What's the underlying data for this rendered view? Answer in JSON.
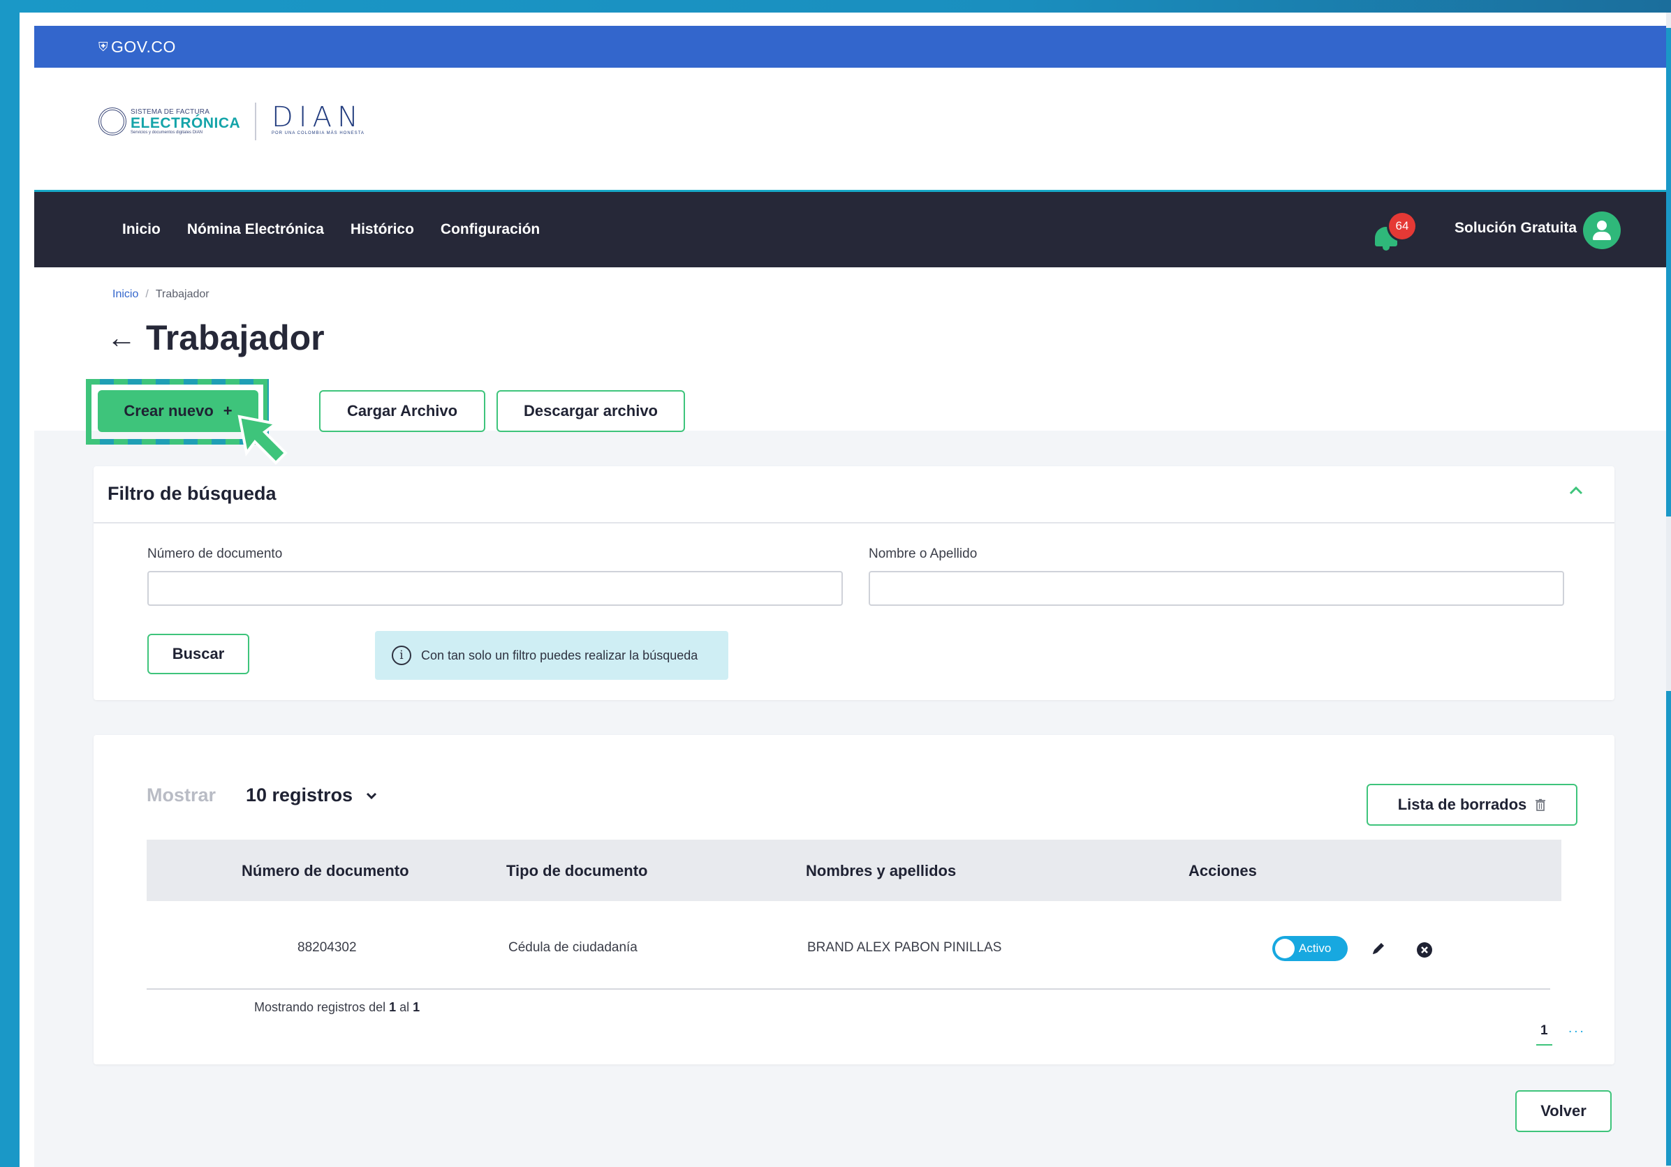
{
  "gov": {
    "logo_text": "GOV.CO"
  },
  "brand": {
    "fe_small": "SISTEMA DE FACTURA",
    "fe_big": "ELECTRÓNICA",
    "fe_sub": "Servicios y documentos digitales DIAN",
    "dian": "DIAN",
    "dian_slogan": "POR UNA COLOMBIA MÁS HONESTA"
  },
  "nav": {
    "items": [
      {
        "label": "Inicio"
      },
      {
        "label": "Nómina Electrónica"
      },
      {
        "label": "Histórico"
      },
      {
        "label": "Configuración"
      }
    ],
    "notifications_count": "64",
    "user_name": "Solución Gratuita",
    "accent_color": "#3ec47b"
  },
  "breadcrumb": {
    "home": "Inicio",
    "separator": "/",
    "current": "Trabajador"
  },
  "page": {
    "title": "Trabajador",
    "back_icon": "←"
  },
  "actions": {
    "create_label": "Crear nuevo",
    "create_icon": "+",
    "upload_label": "Cargar Archivo",
    "download_label": "Descargar archivo"
  },
  "filter": {
    "title": "Filtro de búsqueda",
    "doc_label": "Número de documento",
    "doc_value": "",
    "name_label": "Nombre o Apellido",
    "name_value": "",
    "search_label": "Buscar",
    "info_text": "Con tan solo un filtro puedes realizar la búsqueda"
  },
  "table": {
    "show_label": "Mostrar",
    "page_size": "10 registros",
    "deleted_list_label": "Lista de borrados",
    "columns": [
      "Número de documento",
      "Tipo de documento",
      "Nombres y apellidos",
      "Acciones"
    ],
    "rows": [
      {
        "doc_number": "88204302",
        "doc_type": "Cédula de ciudadanía",
        "name": "BRAND ALEX PABON PINILLAS",
        "status": "Activo"
      }
    ],
    "footer_prefix": "Mostrando registros del ",
    "footer_from": "1",
    "footer_mid": " al ",
    "footer_to": "1",
    "current_page": "1",
    "more_pages": "..."
  },
  "footer": {
    "back_label": "Volver"
  }
}
